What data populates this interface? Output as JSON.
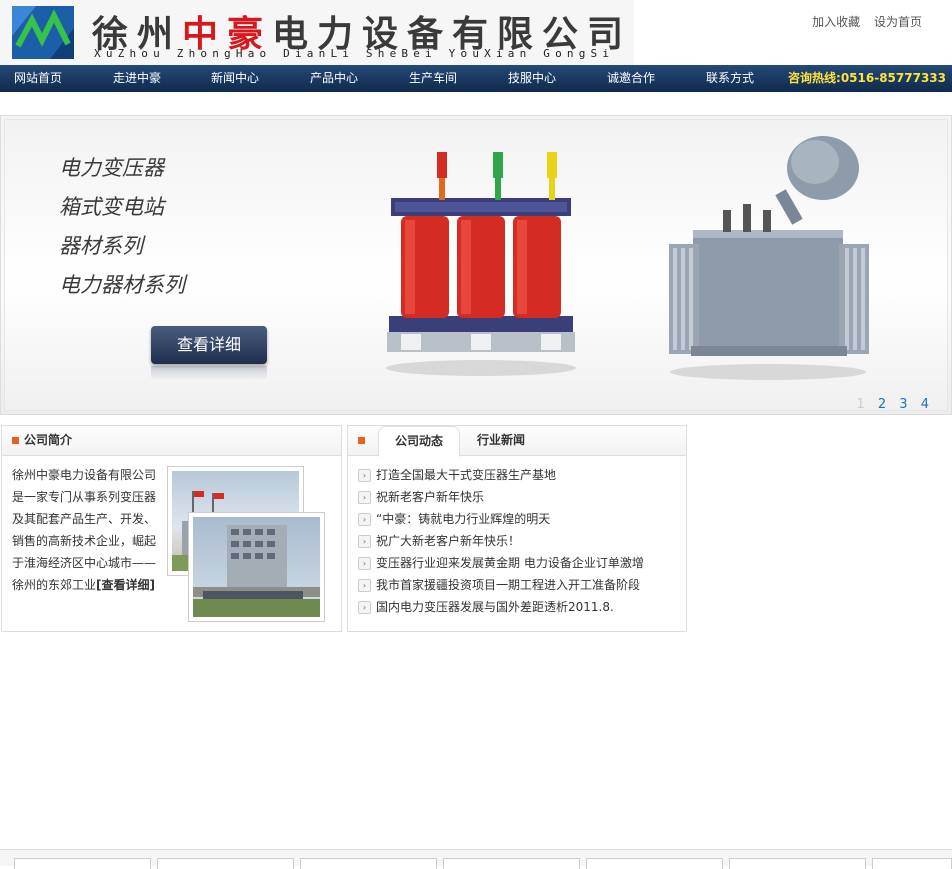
{
  "logo": {
    "cn_part1": "徐州",
    "cn_red": "中豪",
    "cn_part2": "电力设备有限公司",
    "en": "XuZhou ZhongHao DianLi SheBei YouXian GongSi"
  },
  "toplinks": [
    "加入收藏",
    "设为首页"
  ],
  "nav": {
    "items": [
      "网站首页",
      "走进中豪",
      "新闻中心",
      "产品中心",
      "生产车间",
      "技服中心",
      "诚邀合作",
      "联系方式"
    ],
    "hotline": "咨询热线:0516-85777333"
  },
  "banner": {
    "lines": [
      "电力变压器",
      "箱式变电站",
      "器材系列",
      "电力器材系列"
    ],
    "button": "查看详细",
    "pages": [
      "1",
      "2",
      "3",
      "4"
    ],
    "current_page": "1"
  },
  "intro": {
    "title": "公司简介",
    "text": "徐州中豪电力设备有限公司是一家专门从事系列变压器及其配套产品生产、开发、销售的高新技术企业，崛起于淮海经济区中心城市——徐州的东郊工业",
    "more": "[查看详细]"
  },
  "news": {
    "tabs": [
      "公司动态",
      "行业新闻"
    ],
    "items": [
      "打造全国最大干式变压器生产基地",
      "祝新老客户新年快乐",
      "“中豪：铸就电力行业辉煌的明天",
      "祝广大新老客户新年快乐！",
      "变压器行业迎来发展黄金期 电力设备企业订单激增",
      "我市首家援疆投资项目一期工程进入开工准备阶段",
      "国内电力变压器发展与国外差距透析2011.8."
    ]
  },
  "colors": {
    "nav_bg": "#1b3b63",
    "hotline": "#ffe23a",
    "accent_orange": "#e8621b",
    "logo_red": "#d4181d",
    "link_blue": "#1a73c8"
  },
  "icons": [
    "logo-mark-icon",
    "bullet-square-icon",
    "news-arrow-icon"
  ]
}
